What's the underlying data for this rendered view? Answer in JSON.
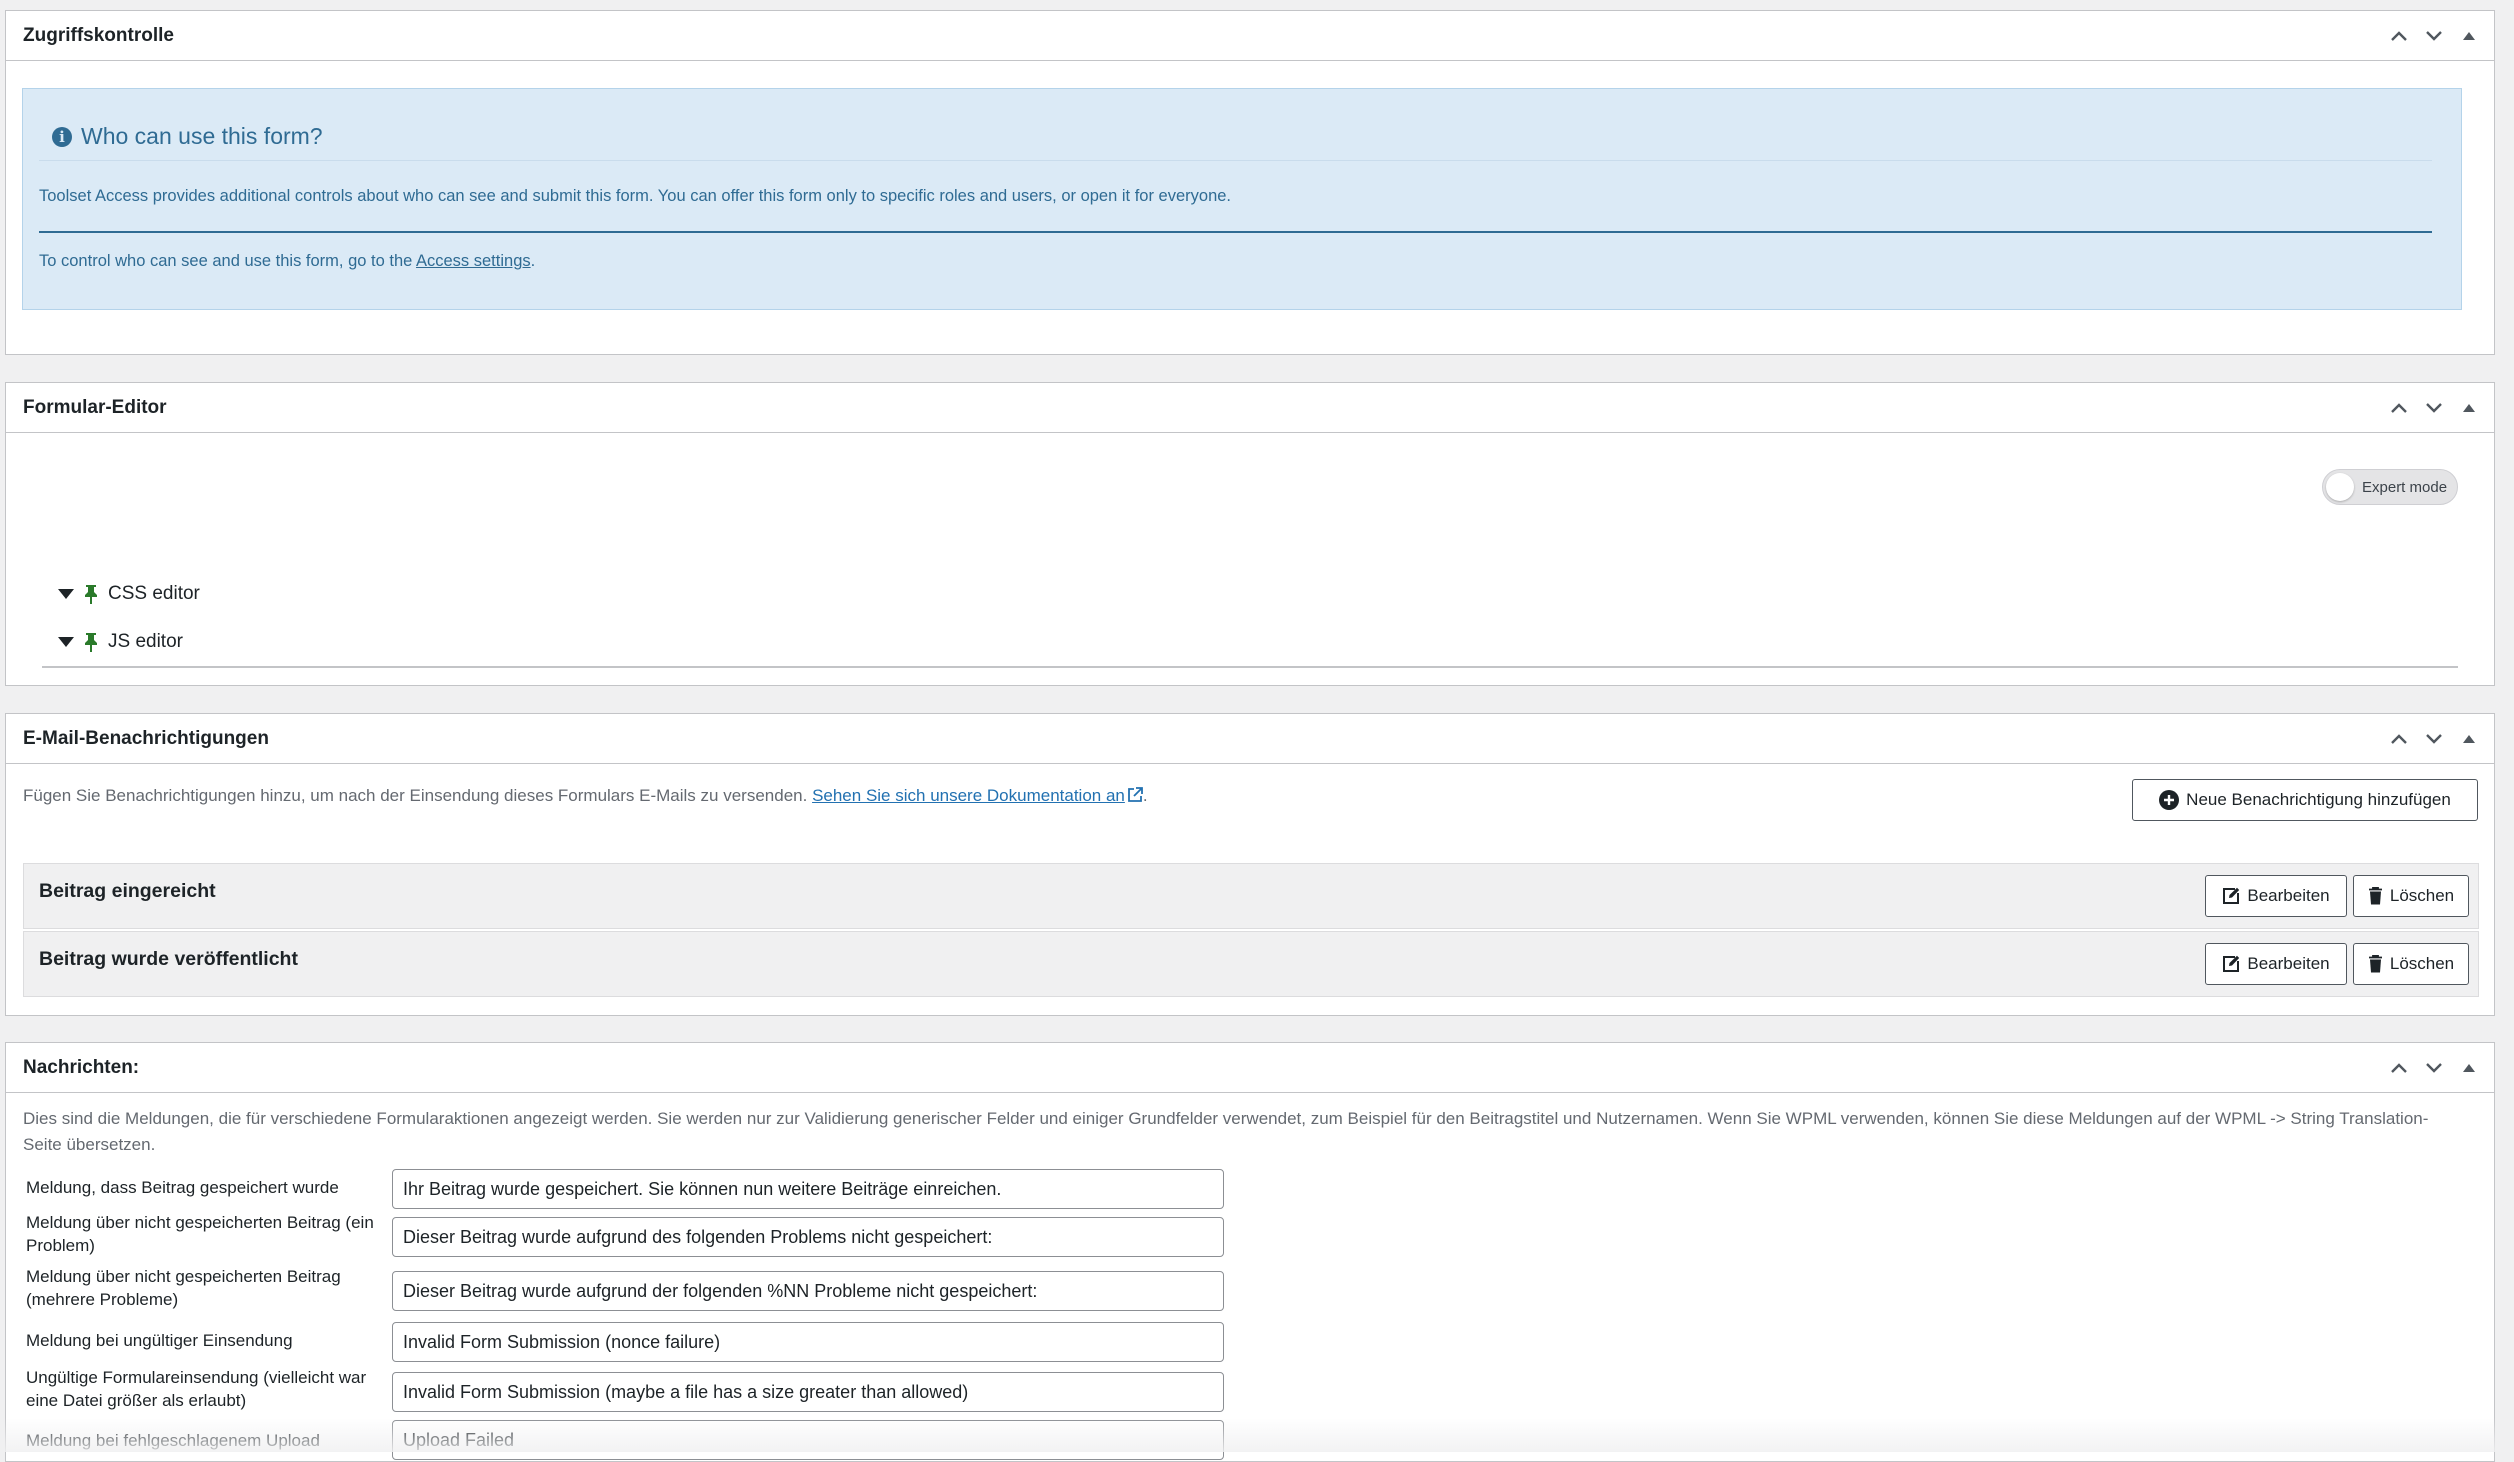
{
  "access": {
    "title": "Zugriffskontrolle",
    "notice_title": "Who can use this form?",
    "notice_text": "Toolset Access provides additional controls about who can see and submit this form. You can offer this form only to specific roles and users, or open it for everyone.",
    "control_prefix": "To control who can see and use this form, go to the ",
    "control_link": "Access settings",
    "control_suffix": "."
  },
  "editor": {
    "title": "Formular-Editor",
    "expert_mode_label": "Expert mode",
    "expert_mode_on": false,
    "css_label": "CSS editor",
    "js_label": "JS editor"
  },
  "email": {
    "title": "E-Mail-Benachrichtigungen",
    "desc": "Fügen Sie Benachrichtigungen hinzu, um nach der Einsendung dieses Formulars E-Mails zu versenden. ",
    "doc_link": "Sehen Sie sich unsere Dokumentation an",
    "desc_suffix": ".",
    "add_button": "Neue Benachrichtigung hinzufügen",
    "notifications": [
      {
        "title": "Beitrag eingereicht",
        "edit": "Bearbeiten",
        "delete": "Löschen"
      },
      {
        "title": "Beitrag wurde veröffentlicht",
        "edit": "Bearbeiten",
        "delete": "Löschen"
      }
    ]
  },
  "messages": {
    "title": "Nachrichten:",
    "desc": "Dies sind die Meldungen, die für verschiedene Formularaktionen angezeigt werden. Sie werden nur zur Validierung generischer Felder und einiger Grundfelder verwendet, zum Beispiel für den Beitragstitel und Nutzernamen. Wenn Sie WPML verwenden, können Sie diese Meldungen auf der WPML -> String Translation-Seite übersetzen.",
    "rows": [
      {
        "label": "Meldung, dass Beitrag gespeichert wurde",
        "value": "Ihr Beitrag wurde gespeichert. Sie können nun weitere Beiträge einreichen."
      },
      {
        "label": "Meldung über nicht gespeicherten Beitrag (ein Problem)",
        "value": "Dieser Beitrag wurde aufgrund des folgenden Problems nicht gespeichert:"
      },
      {
        "label": "Meldung über nicht gespeicherten Beitrag (mehrere Probleme)",
        "value": "Dieser Beitrag wurde aufgrund der folgenden %NN Probleme nicht gespeichert:"
      },
      {
        "label": "Meldung bei ungültiger Einsendung",
        "value": "Invalid Form Submission (nonce failure)"
      },
      {
        "label": "Ungültige Formulareinsendung (vielleicht war eine Datei größer als erlaubt)",
        "value": "Invalid Form Submission (maybe a file has a size greater than allowed)"
      },
      {
        "label": "Meldung bei fehlgeschlagenem Upload",
        "value": "Upload Failed"
      }
    ]
  }
}
